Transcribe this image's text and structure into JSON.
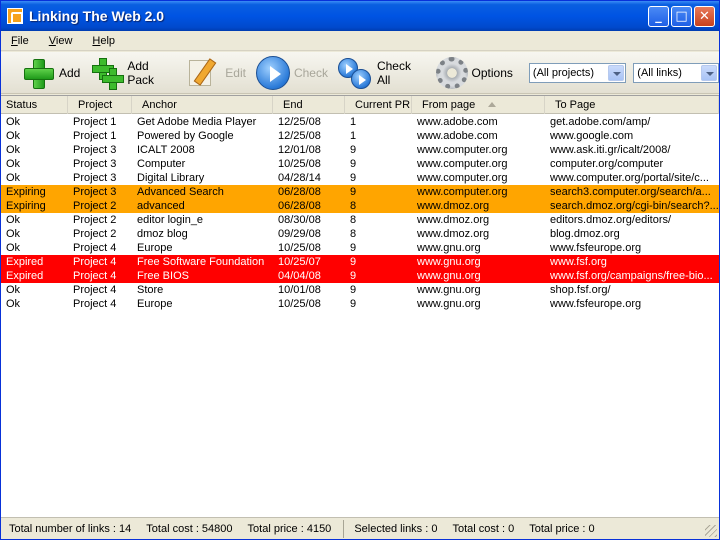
{
  "window": {
    "title": "Linking The Web 2.0"
  },
  "title_buttons": {
    "minimize": "_",
    "maximize": "□",
    "close": "✕"
  },
  "menu": [
    {
      "accel": "F",
      "rest": "ile"
    },
    {
      "accel": "V",
      "rest": "iew"
    },
    {
      "accel": "H",
      "rest": "elp"
    }
  ],
  "toolbar": {
    "add_label": "Add",
    "add_pack_label": "Add Pack",
    "edit_label": "Edit",
    "check_label": "Check",
    "check_all_label": "Check All",
    "options_label": "Options",
    "projects_filter": "(All projects)",
    "links_filter": "(All links)"
  },
  "columns": {
    "status": "Status",
    "project": "Project",
    "anchor": "Anchor",
    "end": "End",
    "current_pr": "Current PR",
    "from_page": "From page",
    "to_page": "To Page"
  },
  "rows": [
    {
      "status": "Ok",
      "project": "Project 1",
      "anchor": "Get Adobe Media Player",
      "end": "12/25/08",
      "pr": "1",
      "from": "www.adobe.com",
      "to": "get.adobe.com/amp/",
      "state": "ok"
    },
    {
      "status": "Ok",
      "project": "Project 1",
      "anchor": "Powered by Google",
      "end": "12/25/08",
      "pr": "1",
      "from": "www.adobe.com",
      "to": "www.google.com",
      "state": "ok"
    },
    {
      "status": "Ok",
      "project": "Project 3",
      "anchor": "ICALT 2008",
      "end": "12/01/08",
      "pr": "9",
      "from": "www.computer.org",
      "to": "www.ask.iti.gr/icalt/2008/",
      "state": "ok"
    },
    {
      "status": "Ok",
      "project": "Project 3",
      "anchor": "Computer",
      "end": "10/25/08",
      "pr": "9",
      "from": "www.computer.org",
      "to": "computer.org/computer",
      "state": "ok"
    },
    {
      "status": "Ok",
      "project": "Project 3",
      "anchor": "Digital Library",
      "end": "04/28/14",
      "pr": "9",
      "from": "www.computer.org",
      "to": "www.computer.org/portal/site/c...",
      "state": "ok"
    },
    {
      "status": "Expiring",
      "project": "Project 3",
      "anchor": "Advanced Search",
      "end": "06/28/08",
      "pr": "9",
      "from": "www.computer.org",
      "to": "search3.computer.org/search/a...",
      "state": "expiring"
    },
    {
      "status": "Expiring",
      "project": "Project 2",
      "anchor": "advanced",
      "end": "06/28/08",
      "pr": "8",
      "from": "www.dmoz.org",
      "to": "search.dmoz.org/cgi-bin/search?...",
      "state": "expiring"
    },
    {
      "status": "Ok",
      "project": "Project 2",
      "anchor": "editor login_e",
      "end": "08/30/08",
      "pr": "8",
      "from": "www.dmoz.org",
      "to": "editors.dmoz.org/editors/",
      "state": "ok"
    },
    {
      "status": "Ok",
      "project": "Project 2",
      "anchor": "dmoz blog",
      "end": "09/29/08",
      "pr": "8",
      "from": "www.dmoz.org",
      "to": "blog.dmoz.org",
      "state": "ok"
    },
    {
      "status": "Ok",
      "project": "Project 4",
      "anchor": "Europe",
      "end": "10/25/08",
      "pr": "9",
      "from": "www.gnu.org",
      "to": "www.fsfeurope.org",
      "state": "ok"
    },
    {
      "status": "Expired",
      "project": "Project 4",
      "anchor": "Free Software Foundation",
      "end": "10/25/07",
      "pr": "9",
      "from": "www.gnu.org",
      "to": "www.fsf.org",
      "state": "expired"
    },
    {
      "status": "Expired",
      "project": "Project 4",
      "anchor": "Free BIOS",
      "end": "04/04/08",
      "pr": "9",
      "from": "www.gnu.org",
      "to": "www.fsf.org/campaigns/free-bio...",
      "state": "expired"
    },
    {
      "status": "Ok",
      "project": "Project 4",
      "anchor": "Store",
      "end": "10/01/08",
      "pr": "9",
      "from": "www.gnu.org",
      "to": "shop.fsf.org/",
      "state": "ok"
    },
    {
      "status": "Ok",
      "project": "Project 4",
      "anchor": "Europe",
      "end": "10/25/08",
      "pr": "9",
      "from": "www.gnu.org",
      "to": "www.fsfeurope.org",
      "state": "ok"
    }
  ],
  "statusbar": {
    "total_links": "Total number of links : 14",
    "total_cost": "Total cost : 54800",
    "total_price": "Total price : 4150",
    "selected_links": "Selected links : 0",
    "selected_cost": "Total cost : 0",
    "selected_price": "Total price : 0"
  },
  "colors": {
    "expiring": "#ffa500",
    "expired": "#ff0000",
    "titlebar": "#0054e3"
  }
}
